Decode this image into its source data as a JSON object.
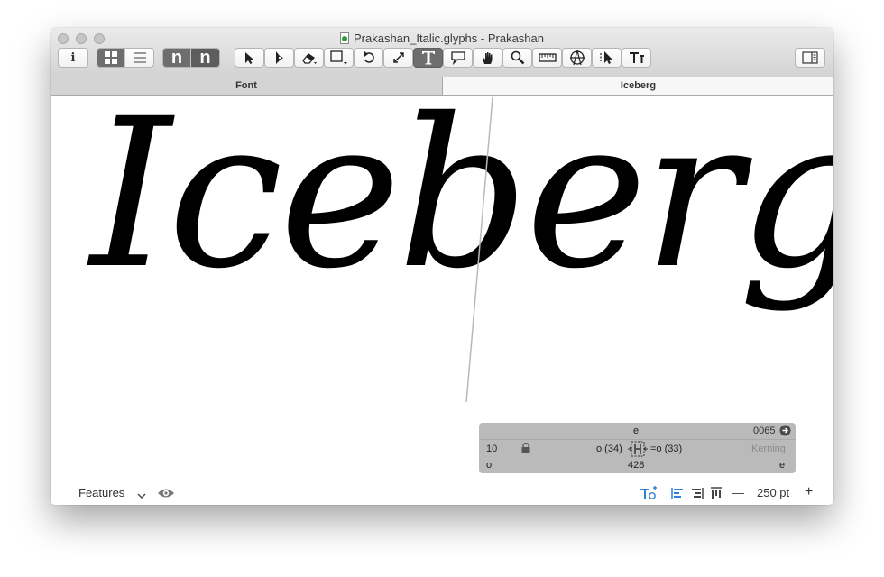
{
  "window": {
    "title": "Prakashan_Italic.glyphs - Prakashan"
  },
  "toolbar": {
    "info_glyph": "i",
    "text_preview_n": "n",
    "text_preview_n2": "n",
    "tools": [
      "select-tool",
      "pen-tool",
      "eraser-tool",
      "primitives-tool",
      "rotate-tool",
      "scale-tool",
      "text-tool",
      "annotation-tool",
      "hand-tool",
      "zoom-tool",
      "measure-tool",
      "anchor-tool",
      "select-all-layers-tool",
      "text-metrics-tool"
    ]
  },
  "tabs": [
    {
      "label": "Font"
    },
    {
      "label": "Iceberg"
    }
  ],
  "canvas": {
    "sample_text": "Iceberg"
  },
  "info_panel": {
    "glyph_name": "e",
    "unicode": "0065",
    "left_value": "10",
    "left_group": "o (34)",
    "right_group": "=o (33)",
    "mode": "Kerning",
    "left_glyph": "o",
    "width": "428",
    "right_glyph": "e"
  },
  "bottom": {
    "features_label": "Features",
    "zoom_minus": "—",
    "font_size": "250 pt",
    "zoom_plus": "+"
  }
}
